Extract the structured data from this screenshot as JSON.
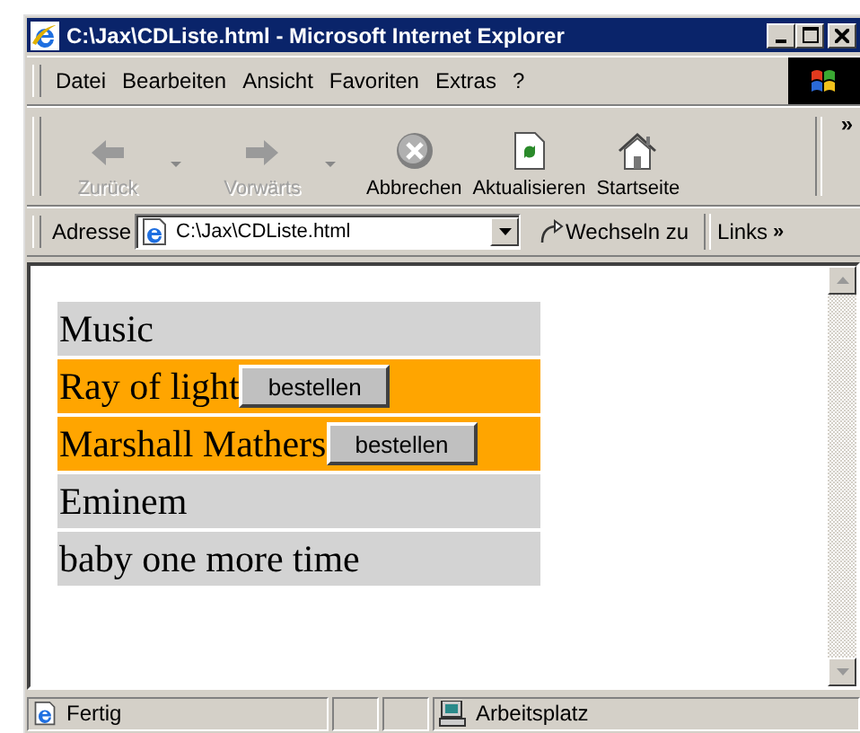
{
  "window": {
    "title": "C:\\Jax\\CDListe.html - Microsoft Internet Explorer"
  },
  "menu": [
    "Datei",
    "Bearbeiten",
    "Ansicht",
    "Favoriten",
    "Extras",
    "?"
  ],
  "toolbar": [
    {
      "kind": "back",
      "label": "Zurück",
      "disabled": true,
      "dropdown": true
    },
    {
      "kind": "forward",
      "label": "Vorwärts",
      "disabled": true,
      "dropdown": true
    },
    {
      "kind": "stop",
      "label": "Abbrechen",
      "disabled": false,
      "dropdown": false
    },
    {
      "kind": "refresh",
      "label": "Aktualisieren",
      "disabled": false,
      "dropdown": false
    },
    {
      "kind": "home",
      "label": "Startseite",
      "disabled": false,
      "dropdown": false
    }
  ],
  "toolbar_more": "»",
  "address_bar": {
    "label": "Adresse",
    "value": "C:\\Jax\\CDListe.html",
    "go": "Wechseln zu",
    "links": "Links",
    "links_more": "»"
  },
  "rows": [
    {
      "text": "Music",
      "highlighted": false
    },
    {
      "text": "Ray of light",
      "highlighted": true,
      "button": "bestellen"
    },
    {
      "text": "Marshall Mathers",
      "highlighted": true,
      "button": "bestellen"
    },
    {
      "text": "Eminem",
      "highlighted": false
    },
    {
      "text": "baby one more time",
      "highlighted": false
    }
  ],
  "status_bar": {
    "status": "Fertig",
    "zone": "Arbeitsplatz"
  }
}
